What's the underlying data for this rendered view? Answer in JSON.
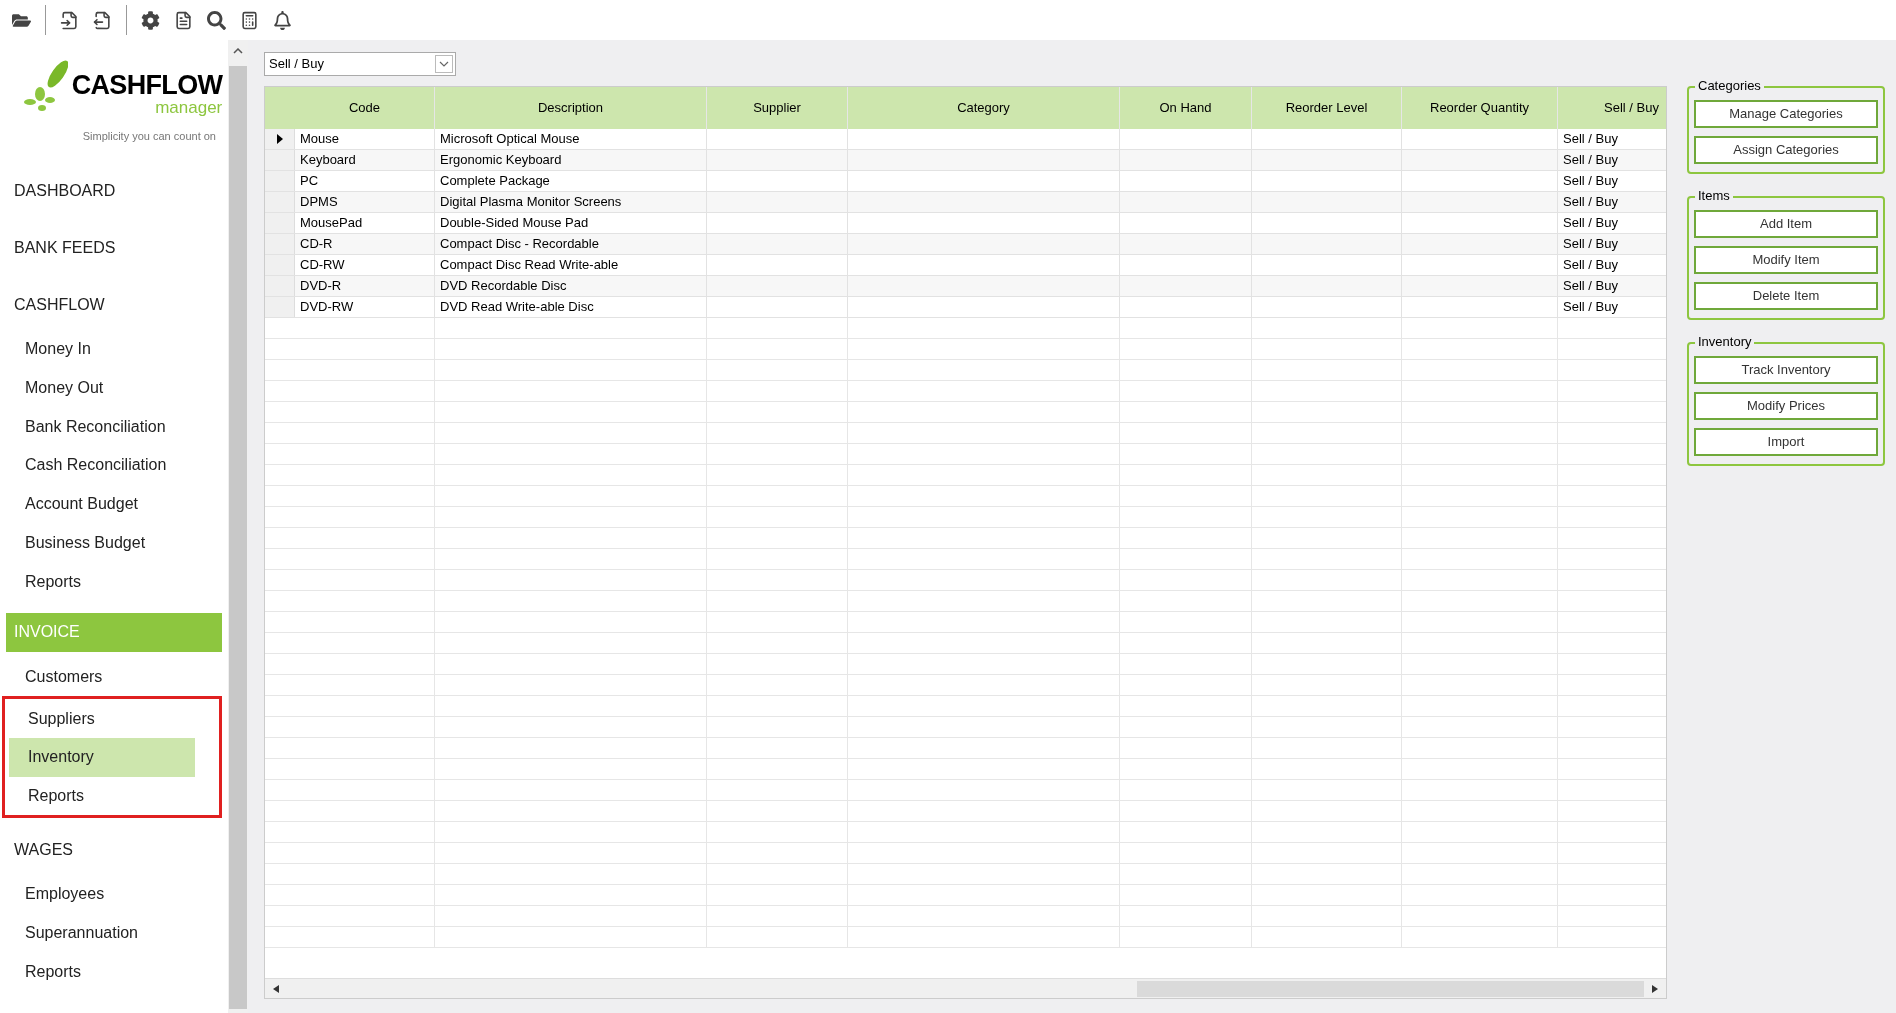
{
  "toolbar": {
    "buttons": [
      {
        "kind": "open"
      },
      {
        "kind": "sep"
      },
      {
        "kind": "import"
      },
      {
        "kind": "export"
      },
      {
        "kind": "sep"
      },
      {
        "kind": "settings"
      },
      {
        "kind": "doc"
      },
      {
        "kind": "search"
      },
      {
        "kind": "calc"
      },
      {
        "kind": "bell"
      }
    ]
  },
  "logo": {
    "name": "CASHFLOW",
    "sub": "manager",
    "tagline": "Simplicity you can count on"
  },
  "sidebar": {
    "items": [
      {
        "kind": "heading",
        "label": "DASHBOARD",
        "selected": false
      },
      {
        "kind": "heading",
        "label": "BANK FEEDS",
        "selected": false
      },
      {
        "kind": "heading",
        "label": "CASHFLOW",
        "selected": false
      },
      {
        "kind": "item",
        "label": "Money In",
        "selected": false
      },
      {
        "kind": "item",
        "label": "Money Out",
        "selected": false
      },
      {
        "kind": "item",
        "label": "Bank Reconciliation",
        "selected": false
      },
      {
        "kind": "item",
        "label": "Cash Reconciliation",
        "selected": false
      },
      {
        "kind": "item",
        "label": "Account Budget",
        "selected": false
      },
      {
        "kind": "item",
        "label": "Business Budget",
        "selected": false
      },
      {
        "kind": "item",
        "label": "Reports",
        "selected": false
      },
      {
        "kind": "heading",
        "label": "INVOICE",
        "selected": true
      },
      {
        "kind": "item",
        "label": "Customers",
        "selected": false
      },
      {
        "kind": "item",
        "label": "Suppliers",
        "selected": false,
        "framed": true
      },
      {
        "kind": "item",
        "label": "Inventory",
        "selected": true,
        "framed": true
      },
      {
        "kind": "item",
        "label": "Reports",
        "selected": false,
        "framed": true
      },
      {
        "kind": "heading",
        "label": "WAGES",
        "selected": false
      },
      {
        "kind": "item",
        "label": "Employees",
        "selected": false
      },
      {
        "kind": "item",
        "label": "Superannuation",
        "selected": false
      },
      {
        "kind": "item",
        "label": "Reports",
        "selected": false
      }
    ]
  },
  "filter": {
    "value": "Sell / Buy"
  },
  "table": {
    "columns": [
      "Code",
      "Description",
      "Supplier",
      "Category",
      "On Hand",
      "Reorder Level",
      "Reorder Quantity",
      "Sell / Buy"
    ],
    "rows": [
      {
        "selected": true,
        "cells": [
          "Mouse",
          "Microsoft Optical Mouse",
          "",
          "",
          "",
          "",
          "",
          "Sell / Buy"
        ]
      },
      {
        "selected": false,
        "cells": [
          "Keyboard",
          "Ergonomic Keyboard",
          "",
          "",
          "",
          "",
          "",
          "Sell / Buy"
        ]
      },
      {
        "selected": false,
        "cells": [
          "PC",
          "Complete Package",
          "",
          "",
          "",
          "",
          "",
          "Sell / Buy"
        ]
      },
      {
        "selected": false,
        "cells": [
          "DPMS",
          "Digital Plasma Monitor Screens",
          "",
          "",
          "",
          "",
          "",
          "Sell / Buy"
        ]
      },
      {
        "selected": false,
        "cells": [
          "MousePad",
          "Double-Sided Mouse Pad",
          "",
          "",
          "",
          "",
          "",
          "Sell / Buy"
        ]
      },
      {
        "selected": false,
        "cells": [
          "CD-R",
          "Compact Disc - Recordable",
          "",
          "",
          "",
          "",
          "",
          "Sell / Buy"
        ]
      },
      {
        "selected": false,
        "cells": [
          "CD-RW",
          "Compact Disc Read Write-able",
          "",
          "",
          "",
          "",
          "",
          "Sell / Buy"
        ]
      },
      {
        "selected": false,
        "cells": [
          "DVD-R",
          "DVD Recordable Disc",
          "",
          "",
          "",
          "",
          "",
          "Sell / Buy"
        ]
      },
      {
        "selected": false,
        "cells": [
          "DVD-RW",
          "DVD Read Write-able Disc",
          "",
          "",
          "",
          "",
          "",
          "Sell / Buy"
        ]
      }
    ]
  },
  "groups": [
    {
      "title": "Categories",
      "buttons": [
        "Manage Categories",
        "Assign Categories"
      ]
    },
    {
      "title": "Items",
      "buttons": [
        "Add Item",
        "Modify Item",
        "Delete Item"
      ]
    },
    {
      "title": "Inventory",
      "buttons": [
        "Track Inventory",
        "Modify Prices",
        "Import"
      ]
    }
  ]
}
